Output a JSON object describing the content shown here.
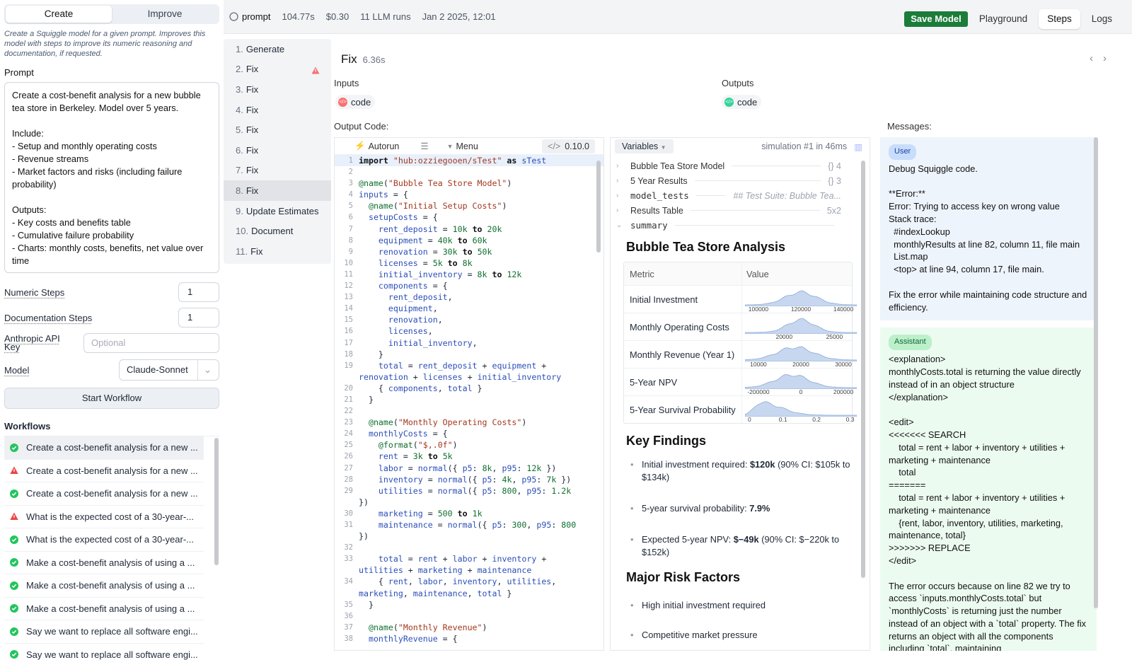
{
  "left": {
    "tabs": [
      "Create",
      "Improve"
    ],
    "description": "Create a Squiggle model for a given prompt. Improves this model with steps to improve its numeric reasoning and documentation, if requested.",
    "prompt_label": "Prompt",
    "prompt_text": "Create a cost-benefit analysis for a new bubble tea store in Berkeley. Model over 5 years.\n\nInclude:\n- Setup and monthly operating costs\n- Revenue streams\n- Market factors and risks (including failure probability)\n\nOutputs:\n- Key costs and benefits table\n- Cumulative failure probability\n- Charts: monthly costs, benefits, net value over time",
    "numeric_steps_label": "Numeric Steps",
    "numeric_steps": "1",
    "doc_steps_label": "Documentation Steps",
    "doc_steps": "1",
    "api_key_label": "Anthropic API Key",
    "api_key_placeholder": "Optional",
    "model_label": "Model",
    "model_value": "Claude-Sonnet",
    "start_button": "Start Workflow",
    "workflows_label": "Workflows",
    "workflows": [
      {
        "status": "ok",
        "text": "Create a cost-benefit analysis for a new ..."
      },
      {
        "status": "warn",
        "text": "Create a cost-benefit analysis for a new ..."
      },
      {
        "status": "ok",
        "text": "Create a cost-benefit analysis for a new ..."
      },
      {
        "status": "warn",
        "text": "What is the expected cost of a 30-year-..."
      },
      {
        "status": "ok",
        "text": "What is the expected cost of a 30-year-..."
      },
      {
        "status": "ok",
        "text": "Make a cost-benefit analysis of using a ..."
      },
      {
        "status": "ok",
        "text": "Make a cost-benefit analysis of using a ..."
      },
      {
        "status": "ok",
        "text": "Make a cost-benefit analysis of using a ..."
      },
      {
        "status": "ok",
        "text": "Say we want to replace all software engi..."
      },
      {
        "status": "ok",
        "text": "Say we want to replace all software engi..."
      }
    ]
  },
  "topbar": {
    "prompt": "prompt",
    "time": "104.77s",
    "cost": "$0.30",
    "runs": "11 LLM runs",
    "date": "Jan 2 2025, 12:01",
    "save": "Save Model",
    "tabs": [
      "Playground",
      "Steps",
      "Logs"
    ]
  },
  "steps": [
    {
      "n": "1.",
      "label": "Generate"
    },
    {
      "n": "2.",
      "label": "Fix",
      "warn": true
    },
    {
      "n": "3.",
      "label": "Fix"
    },
    {
      "n": "4.",
      "label": "Fix"
    },
    {
      "n": "5.",
      "label": "Fix"
    },
    {
      "n": "6.",
      "label": "Fix"
    },
    {
      "n": "7.",
      "label": "Fix"
    },
    {
      "n": "8.",
      "label": "Fix"
    },
    {
      "n": "9.",
      "label": "Update Estimates"
    },
    {
      "n": "10.",
      "label": "Document"
    },
    {
      "n": "11.",
      "label": "Fix"
    }
  ],
  "main": {
    "title": "Fix",
    "duration": "6.36s",
    "inputs_label": "Inputs",
    "inputs_chip": "code",
    "outputs_label": "Outputs",
    "outputs_chip": "code",
    "output_code_label": "Output Code:",
    "messages_label": "Messages:",
    "editor": {
      "autorun": "Autorun",
      "menu": "Menu",
      "version": "0.10.0"
    },
    "vars": {
      "button": "Variables",
      "sim": "simulation #1 in 46ms",
      "rows": [
        {
          "name": "Bubble Tea Store Model",
          "tag": "{} 4",
          "mono": false
        },
        {
          "name": "5 Year Results",
          "tag": "{} 3",
          "mono": false
        },
        {
          "name": "model_tests",
          "tag": "## Test Suite: Bubble Tea...",
          "mono": true
        },
        {
          "name": "Results Table",
          "tag": "5x2",
          "mono": false
        },
        {
          "name": "summary",
          "tag": "",
          "mono": true
        }
      ],
      "heading": "Bubble Tea Store Analysis",
      "table_header": [
        "Metric",
        "Value"
      ],
      "table": [
        {
          "metric": "Initial Investment",
          "ticks": [
            "100000",
            "120000",
            "140000"
          ]
        },
        {
          "metric": "Monthly Operating Costs",
          "ticks": [
            "20000",
            "25000"
          ]
        },
        {
          "metric": "Monthly Revenue (Year 1)",
          "ticks": [
            "10000",
            "20000",
            "30000"
          ]
        },
        {
          "metric": "5-Year NPV",
          "ticks": [
            "-200000",
            "0",
            "200000"
          ]
        },
        {
          "metric": "5-Year Survival Probability",
          "ticks": [
            "0",
            "0.1",
            "0.2",
            "0.3"
          ]
        }
      ],
      "key_findings": "Key Findings",
      "findings": [
        {
          "pre": "Initial investment required: ",
          "b": "$120k",
          "post": " (90% CI: $105k to $134k)"
        },
        {
          "pre": "5-year survival probability: ",
          "b": "7.9%",
          "post": ""
        },
        {
          "pre": "Expected 5-year NPV: ",
          "b": "$−49k",
          "post": " (90% CI: $−220k to $152k)"
        }
      ],
      "risk_heading": "Major Risk Factors",
      "risks": [
        "High initial investment required",
        "Competitive market pressure"
      ]
    },
    "messages": {
      "user_role": "User",
      "user_text": "Debug Squiggle code.\n\n**Error:**\nError: Trying to access key on wrong value\nStack trace:\n  #indexLookup\n  monthlyResults at line 82, column 11, file main\n  List.map\n  <top> at line 94, column 17, file main.\n\nFix the error while maintaining code structure and efficiency.",
      "assistant_role": "Assistant",
      "assistant_text": "<explanation>\nmonthlyCosts.total is returning the value directly instead of in an object structure\n</explanation>\n\n<edit>\n<<<<<<< SEARCH\n    total = rent + labor + inventory + utilities + marketing + maintenance\n    total\n=======\n    total = rent + labor + inventory + utilities + marketing + maintenance\n    {rent, labor, inventory, utilities, marketing, maintenance, total}\n>>>>>>> REPLACE\n</edit>\n\nThe error occurs because on line 82 we try to access `inputs.monthlyCosts.total` but `monthlyCosts` is returning just the number instead of an object with a `total` property. The fix returns an object with all the components including `total`, maintaining"
    }
  },
  "code": [
    {
      "n": "1",
      "c": "import \"hub:ozziegooen/sTest\" as sTest",
      "hl": true
    },
    {
      "n": "2",
      "c": ""
    },
    {
      "n": "3",
      "c": "@name(\"Bubble Tea Store Model\")"
    },
    {
      "n": "4",
      "c": "inputs = {",
      "fold": true
    },
    {
      "n": "5",
      "c": "  @name(\"Initial Setup Costs\")"
    },
    {
      "n": "6",
      "c": "  setupCosts = {",
      "fold": true
    },
    {
      "n": "7",
      "c": "    rent_deposit = 10k to 20k"
    },
    {
      "n": "8",
      "c": "    equipment = 40k to 60k"
    },
    {
      "n": "9",
      "c": "    renovation = 30k to 50k"
    },
    {
      "n": "10",
      "c": "    licenses = 5k to 8k"
    },
    {
      "n": "11",
      "c": "    initial_inventory = 8k to 12k"
    },
    {
      "n": "12",
      "c": "    components = {",
      "fold": true
    },
    {
      "n": "13",
      "c": "      rent_deposit,"
    },
    {
      "n": "14",
      "c": "      equipment,"
    },
    {
      "n": "15",
      "c": "      renovation,"
    },
    {
      "n": "16",
      "c": "      licenses,"
    },
    {
      "n": "17",
      "c": "      initial_inventory,"
    },
    {
      "n": "18",
      "c": "    }"
    },
    {
      "n": "19",
      "c": "    total = rent_deposit + equipment +"
    },
    {
      "n": "",
      "c": "renovation + licenses + initial_inventory"
    },
    {
      "n": "20",
      "c": "    { components, total }"
    },
    {
      "n": "21",
      "c": "  }"
    },
    {
      "n": "22",
      "c": ""
    },
    {
      "n": "23",
      "c": "  @name(\"Monthly Operating Costs\")"
    },
    {
      "n": "24",
      "c": "  monthlyCosts = {",
      "fold": true
    },
    {
      "n": "25",
      "c": "    @format(\"$,.0f\")"
    },
    {
      "n": "26",
      "c": "    rent = 3k to 5k"
    },
    {
      "n": "27",
      "c": "    labor = normal({ p5: 8k, p95: 12k })"
    },
    {
      "n": "28",
      "c": "    inventory = normal({ p5: 4k, p95: 7k })"
    },
    {
      "n": "29",
      "c": "    utilities = normal({ p5: 800, p95: 1.2k"
    },
    {
      "n": "",
      "c": "})"
    },
    {
      "n": "30",
      "c": "    marketing = 500 to 1k"
    },
    {
      "n": "31",
      "c": "    maintenance = normal({ p5: 300, p95: 800"
    },
    {
      "n": "",
      "c": "})"
    },
    {
      "n": "32",
      "c": ""
    },
    {
      "n": "33",
      "c": "    total = rent + labor + inventory +"
    },
    {
      "n": "",
      "c": "utilities + marketing + maintenance"
    },
    {
      "n": "34",
      "c": "    { rent, labor, inventory, utilities,"
    },
    {
      "n": "",
      "c": "marketing, maintenance, total }"
    },
    {
      "n": "35",
      "c": "  }"
    },
    {
      "n": "36",
      "c": ""
    },
    {
      "n": "37",
      "c": "  @name(\"Monthly Revenue\")"
    },
    {
      "n": "38",
      "c": "  monthlyRevenue = {",
      "fold": true
    }
  ],
  "colors": {
    "save": "#1c7c3a",
    "ok": "#22c55e",
    "warn": "#ef4444",
    "user_bg": "#eef4fc",
    "assistant_bg": "#ecfbf0"
  }
}
